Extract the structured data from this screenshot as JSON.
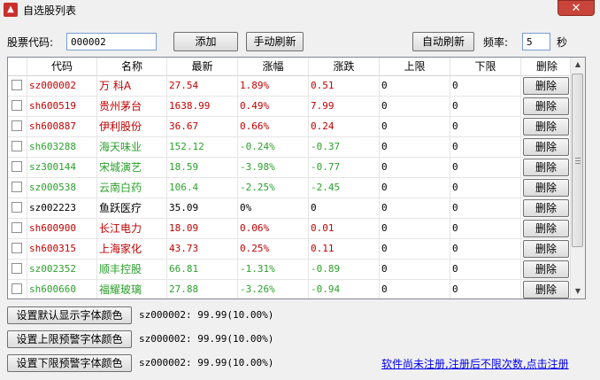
{
  "window": {
    "title": "自选股列表",
    "close": "✕"
  },
  "toolbar": {
    "code_label": "股票代码:",
    "code_value": "000002",
    "add_label": "添加",
    "manual_refresh_label": "手动刷新",
    "auto_refresh_label": "自动刷新",
    "freq_label": "频率:",
    "freq_value": "5",
    "sec_label": "秒"
  },
  "table": {
    "headers": [
      "代码",
      "名称",
      "最新",
      "涨幅",
      "涨跌",
      "上限",
      "下限",
      "删除"
    ],
    "rows": [
      {
        "code": "sz000002",
        "name": "万 科A",
        "last": "27.54",
        "pct": "1.89%",
        "chg": "0.51",
        "upper": "0",
        "lower": "0",
        "del": "删除",
        "color": "#c00000"
      },
      {
        "code": "sh600519",
        "name": "贵州茅台",
        "last": "1638.99",
        "pct": "0.49%",
        "chg": "7.99",
        "upper": "0",
        "lower": "0",
        "del": "删除",
        "color": "#c00000"
      },
      {
        "code": "sh600887",
        "name": "伊利股份",
        "last": "36.67",
        "pct": "0.66%",
        "chg": "0.24",
        "upper": "0",
        "lower": "0",
        "del": "删除",
        "color": "#c00000"
      },
      {
        "code": "sh603288",
        "name": "海天味业",
        "last": "152.12",
        "pct": "-0.24%",
        "chg": "-0.37",
        "upper": "0",
        "lower": "0",
        "del": "删除",
        "color": "#2ca02c"
      },
      {
        "code": "sz300144",
        "name": "宋城演艺",
        "last": "18.59",
        "pct": "-3.98%",
        "chg": "-0.77",
        "upper": "0",
        "lower": "0",
        "del": "删除",
        "color": "#2ca02c"
      },
      {
        "code": "sz000538",
        "name": "云南白药",
        "last": "106.4",
        "pct": "-2.25%",
        "chg": "-2.45",
        "upper": "0",
        "lower": "0",
        "del": "删除",
        "color": "#2ca02c"
      },
      {
        "code": "sz002223",
        "name": "鱼跃医疗",
        "last": "35.09",
        "pct": "0%",
        "chg": "0",
        "upper": "0",
        "lower": "0",
        "del": "删除",
        "color": "#000000"
      },
      {
        "code": "sh600900",
        "name": "长江电力",
        "last": "18.09",
        "pct": "0.06%",
        "chg": "0.01",
        "upper": "0",
        "lower": "0",
        "del": "删除",
        "color": "#c00000"
      },
      {
        "code": "sh600315",
        "name": "上海家化",
        "last": "43.73",
        "pct": "0.25%",
        "chg": "0.11",
        "upper": "0",
        "lower": "0",
        "del": "删除",
        "color": "#c00000"
      },
      {
        "code": "sz002352",
        "name": "顺丰控股",
        "last": "66.81",
        "pct": "-1.31%",
        "chg": "-0.89",
        "upper": "0",
        "lower": "0",
        "del": "删除",
        "color": "#2ca02c"
      },
      {
        "code": "sh600660",
        "name": "福耀玻璃",
        "last": "27.88",
        "pct": "-3.26%",
        "chg": "-0.94",
        "upper": "0",
        "lower": "0",
        "del": "删除",
        "color": "#2ca02c"
      }
    ]
  },
  "footer": {
    "default_color_label": "设置默认显示字体颜色",
    "default_color_text": "sz000002: 99.99(10.00%)",
    "upper_color_label": "设置上限预警字体颜色",
    "upper_color_text": "sz000002: 99.99(10.00%)",
    "lower_color_label": "设置下限预警字体颜色",
    "lower_color_text": "sz000002: 99.99(10.00%)",
    "register_link": "软件尚未注册,注册后不限次数,点击注册"
  },
  "icons": {
    "app": "stock-app-icon",
    "up": "scroll-up-icon",
    "down": "scroll-down-icon"
  },
  "colors": {
    "up": "#c00000",
    "down": "#2ca02c",
    "flat": "#000000"
  }
}
